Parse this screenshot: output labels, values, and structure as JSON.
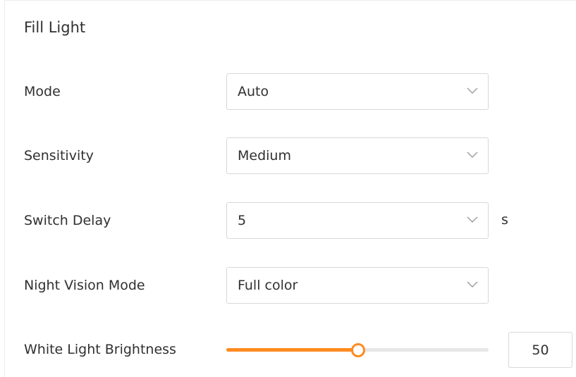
{
  "section": {
    "title": "Fill Light"
  },
  "fields": {
    "mode": {
      "label": "Mode",
      "value": "Auto"
    },
    "sensitivity": {
      "label": "Sensitivity",
      "value": "Medium"
    },
    "switch_delay": {
      "label": "Switch Delay",
      "value": "5",
      "unit": "s"
    },
    "night_vision_mode": {
      "label": "Night Vision Mode",
      "value": "Full color"
    },
    "white_light_brightness": {
      "label": "White Light Brightness",
      "value": "50",
      "level": 0.5
    }
  },
  "icons": {
    "dropdown": "chevron-down-icon"
  },
  "colors": {
    "accent": "#ff8a1f",
    "track": "#e6e6e6",
    "border": "#d8d8d8",
    "text": "#303030"
  }
}
